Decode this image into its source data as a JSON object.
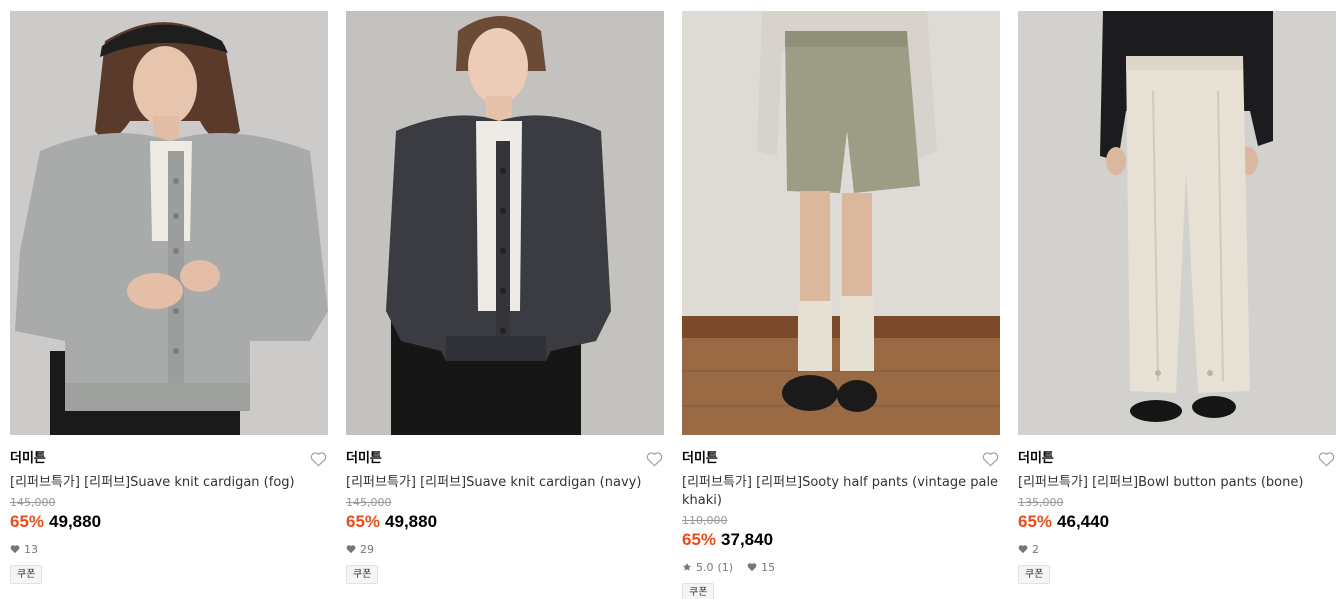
{
  "products": [
    {
      "brand": "더미튼",
      "name": "[리퍼브특가] [리퍼브]Suave knit cardigan (fog)",
      "original_price": "145,000",
      "discount": "65%",
      "price": "49,880",
      "rating": "",
      "review_count": "",
      "likes": "13",
      "badge": "쿠폰",
      "image": "woman in light grey knit cardigan over white tee with black skirt and black beret"
    },
    {
      "brand": "더미튼",
      "name": "[리퍼브특가] [리퍼브]Suave knit cardigan (navy)",
      "original_price": "145,000",
      "discount": "65%",
      "price": "49,880",
      "rating": "",
      "review_count": "",
      "likes": "29",
      "badge": "쿠폰",
      "image": "woman in dark navy knit cardigan over white tee with black skirt"
    },
    {
      "brand": "더미튼",
      "name": "[리퍼브특가] [리퍼브]Sooty half pants (vintage pale khaki)",
      "original_price": "110,000",
      "discount": "65%",
      "price": "37,840",
      "rating": "5.0",
      "review_count": "(1)",
      "likes": "15",
      "badge": "쿠폰",
      "image": "khaki half pants with cream socks and black shoes on wooden floor"
    },
    {
      "brand": "더미튼",
      "name": "[리퍼브특가] [리퍼브]Bowl button pants (bone)",
      "original_price": "135,000",
      "discount": "65%",
      "price": "46,440",
      "rating": "",
      "review_count": "",
      "likes": "2",
      "badge": "쿠폰",
      "image": "bone colored wide pants with black jacket and black loafers"
    }
  ],
  "colors": {
    "discount": "#e84d1c",
    "price": "#000000",
    "muted": "#999999",
    "badge_bg": "#f5f5f5"
  },
  "icons": {
    "wish": "heart-outline-icon",
    "likes": "heart-filled-icon",
    "rating": "star-icon"
  }
}
